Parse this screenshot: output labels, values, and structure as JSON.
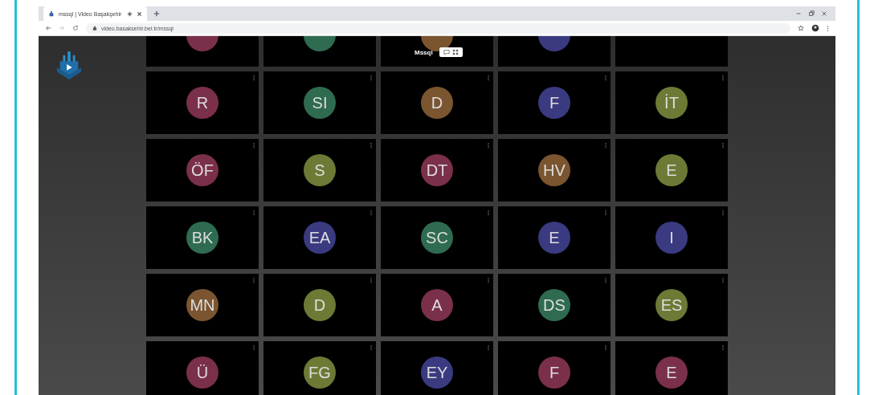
{
  "browser": {
    "tab_title": "mssql | Video Başakşehir",
    "url": "video.basaksehir.bel.tr/mssql"
  },
  "overlay": {
    "room_name": "Mssql"
  },
  "tiles": [
    {
      "kind": "avatar",
      "color": "#7a2f4a"
    },
    {
      "kind": "avatar",
      "color": "#2f6b50"
    },
    {
      "kind": "avatar",
      "color": "#7a5530"
    },
    {
      "kind": "avatar",
      "color": "#3a3a80"
    },
    {
      "kind": "empty"
    },
    {
      "kind": "avatar",
      "initials": "R",
      "color": "#7a2f4a"
    },
    {
      "kind": "avatar",
      "initials": "SI",
      "color": "#2f6b50"
    },
    {
      "kind": "avatar",
      "initials": "D",
      "color": "#7a5530"
    },
    {
      "kind": "avatar",
      "initials": "F",
      "color": "#3a3a80"
    },
    {
      "kind": "avatar",
      "initials": "İT",
      "color": "#6b7a35"
    },
    {
      "kind": "avatar",
      "initials": "ÖF",
      "color": "#7a2f4a"
    },
    {
      "kind": "avatar",
      "initials": "S",
      "color": "#6b7a35"
    },
    {
      "kind": "avatar",
      "initials": "DT",
      "color": "#7a2f4a"
    },
    {
      "kind": "avatar",
      "initials": "HV",
      "color": "#7a5530"
    },
    {
      "kind": "avatar",
      "initials": "E",
      "color": "#6b7a35"
    },
    {
      "kind": "avatar",
      "initials": "BK",
      "color": "#2f6b50"
    },
    {
      "kind": "avatar",
      "initials": "EA",
      "color": "#3a3a80"
    },
    {
      "kind": "avatar",
      "initials": "SC",
      "color": "#2f6b50"
    },
    {
      "kind": "avatar",
      "initials": "E",
      "color": "#3a3a80"
    },
    {
      "kind": "avatar",
      "initials": "I",
      "color": "#3a3a80"
    },
    {
      "kind": "avatar",
      "initials": "MN",
      "color": "#7a5530"
    },
    {
      "kind": "avatar",
      "initials": "D",
      "color": "#6b7a35"
    },
    {
      "kind": "avatar",
      "initials": "A",
      "color": "#7a2f4a"
    },
    {
      "kind": "avatar",
      "initials": "DS",
      "color": "#2f6b50"
    },
    {
      "kind": "avatar",
      "initials": "ES",
      "color": "#6b7a35"
    },
    {
      "kind": "avatar",
      "initials": "Ü",
      "color": "#7a2f4a"
    },
    {
      "kind": "avatar",
      "initials": "FG",
      "color": "#6b7a35"
    },
    {
      "kind": "avatar",
      "initials": "EY",
      "color": "#3a3a80"
    },
    {
      "kind": "avatar",
      "initials": "F",
      "color": "#7a2f4a"
    },
    {
      "kind": "avatar",
      "initials": "E",
      "color": "#7a2f4a"
    }
  ]
}
